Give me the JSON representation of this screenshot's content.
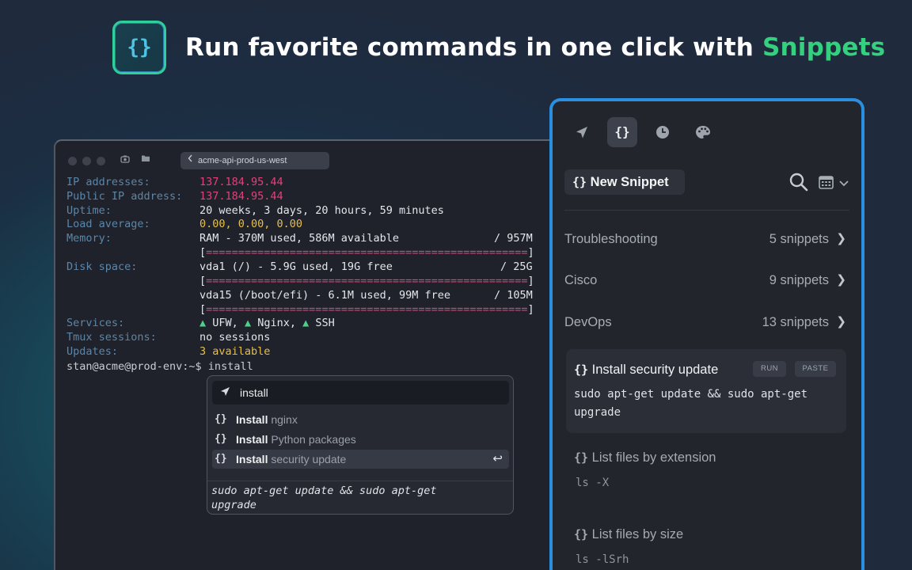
{
  "header": {
    "logo_glyph": "{}",
    "headline_prefix": "Run favorite commands in one click with ",
    "headline_accent": "Snippets",
    "accent_color": "#34d07f"
  },
  "terminal": {
    "tab_title": "acme-api-prod-us-west",
    "lines": {
      "ip_label": "IP addresses:",
      "ip_value": "137.184.95.44",
      "public_ip_label": "Public IP address:",
      "public_ip_value": "137.184.95.44",
      "uptime_label": "Uptime:",
      "uptime_value": "20 weeks, 3 days, 20 hours, 59 minutes",
      "load_label": "Load average:",
      "load_value": "0.00, 0.00, 0.00",
      "memory_label": "Memory:",
      "memory_value": "RAM - 370M used, 586M available",
      "memory_total": "/ 957M",
      "disk_label": "Disk space:",
      "disk1_value": "vda1 (/) - 5.9G used, 19G free",
      "disk1_total": "/ 25G",
      "disk2_value": "vda15 (/boot/efi) - 6.1M used, 99M free",
      "disk2_total": "/ 105M",
      "bar_open": "[",
      "bar_fill": "==================================================",
      "bar_close": "]",
      "services_label": "Services:",
      "service1": "UFW,",
      "service2": "Nginx,",
      "service3": "SSH",
      "service_marker": "▲",
      "tmux_label": "Tmux sessions:",
      "tmux_value": "no sessions",
      "updates_label": "Updates:",
      "updates_value": "3 available",
      "prompt": "stan@acme@prod-env:~$ install"
    }
  },
  "autocomplete": {
    "query": "install",
    "items": [
      {
        "bold": "Install",
        "rest": " nginx"
      },
      {
        "bold": "Install",
        "rest": " Python packages"
      },
      {
        "bold": "Install",
        "rest": " security update"
      }
    ],
    "selected_index": 2,
    "enter_glyph": "↩",
    "preview_line1": "sudo apt-get update && sudo apt-get",
    "preview_line2": "upgrade"
  },
  "panel": {
    "tabs": [
      "rocket-icon",
      "braces-icon",
      "history-icon",
      "palette-icon"
    ],
    "active_tab_glyph": "{}",
    "new_snippet_braces": "{}",
    "new_snippet_label": "New Snippet",
    "folders": [
      {
        "name": "Troubleshooting",
        "count": "5 snippets"
      },
      {
        "name": "Cisco",
        "count": "9 snippets"
      },
      {
        "name": "DevOps",
        "count": "13 snippets"
      }
    ],
    "snippets": [
      {
        "title": "Install security update",
        "code_line1": "sudo apt-get update && sudo apt-get",
        "code_line2": "upgrade",
        "run": "RUN",
        "paste": "PASTE"
      },
      {
        "title": "List files by extension",
        "code": "ls -X"
      },
      {
        "title": "List files by size",
        "code": "ls -lSrh"
      }
    ],
    "accent_border": "#2b8fe0"
  }
}
